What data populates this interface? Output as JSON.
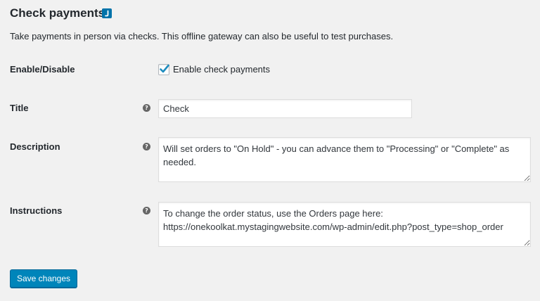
{
  "page": {
    "title": "Check payments",
    "link_icon": "external-link-icon",
    "description": "Take payments in person via checks. This offline gateway can also be useful to test purchases."
  },
  "fields": {
    "enable": {
      "label": "Enable/Disable",
      "checkbox_label": "Enable check payments",
      "checked": true
    },
    "title": {
      "label": "Title",
      "help_icon": "help-icon",
      "value": "Check"
    },
    "description": {
      "label": "Description",
      "help_icon": "help-icon",
      "value": "Will set orders to \"On Hold\" - you can advance them to \"Processing\" or \"Complete\" as needed."
    },
    "instructions": {
      "label": "Instructions",
      "help_icon": "help-icon",
      "value": "To change the order status, use the Orders page here: https://onekoolkat.mystagingwebsite.com/wp-admin/edit.php?post_type=shop_order"
    }
  },
  "actions": {
    "save_label": "Save changes"
  },
  "colors": {
    "background": "#f1f1f1",
    "primary_button": "#0085ba",
    "link_icon": "#0073aa",
    "checkmark": "#1e8cbe"
  }
}
